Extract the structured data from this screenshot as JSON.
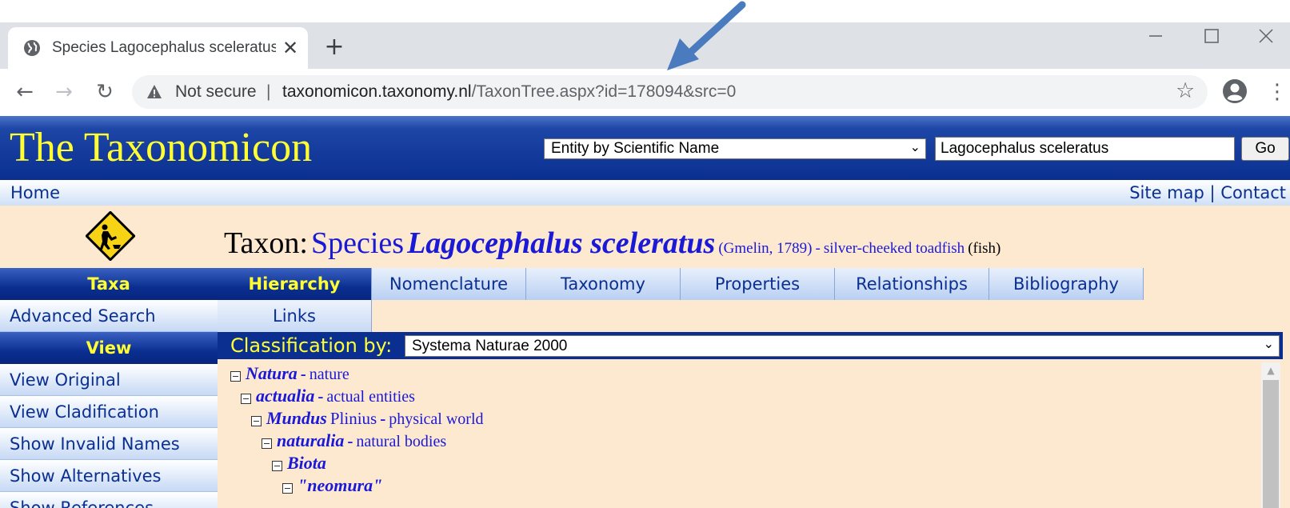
{
  "browser": {
    "tab_title": "Species Lagocephalus sceleratus",
    "tab_close": "✕",
    "new_tab": "+",
    "security_label": "Not secure",
    "omnibox_separator": "|",
    "url_host": "taxonomicon.taxonomy.nl",
    "url_path": "/TaxonTree.aspx?id=178094&src=0",
    "back_icon": "←",
    "forward_icon": "→",
    "reload_icon": "↻",
    "star_icon": "☆",
    "menu_icon": "⋮"
  },
  "header": {
    "site_title": "The Taxonomicon",
    "search_mode": "Entity by Scientific Name",
    "search_value": "Lagocephalus sceleratus",
    "go_label": "Go"
  },
  "navbar": {
    "home": "Home",
    "site_map": "Site map",
    "separator": "|",
    "contact": "Contact"
  },
  "sidebar": [
    {
      "kind": "head",
      "label": "Taxa"
    },
    {
      "kind": "item",
      "label": "Advanced Search"
    },
    {
      "kind": "head",
      "label": "View"
    },
    {
      "kind": "item",
      "label": "View Original"
    },
    {
      "kind": "item",
      "label": "View Cladification"
    },
    {
      "kind": "item",
      "label": "Show Invalid Names"
    },
    {
      "kind": "item",
      "label": "Show Alternatives"
    },
    {
      "kind": "item",
      "label": "Show References"
    }
  ],
  "taxon": {
    "label": "Taxon:",
    "rank": "Species",
    "name": "Lagocephalus sceleratus",
    "author": "(Gmelin, 1789)",
    "common_prefix": "-",
    "common_name": "silver-cheeked toadfish",
    "group": "(fish)"
  },
  "tabs": {
    "row1": [
      "Hierarchy",
      "Nomenclature",
      "Taxonomy",
      "Properties",
      "Relationships",
      "Bibliography"
    ],
    "row2": [
      "Links"
    ],
    "active": "Hierarchy"
  },
  "classification": {
    "label": "Classification by:",
    "selected": "Systema Naturae 2000"
  },
  "tree": [
    {
      "name": "Natura",
      "author": "",
      "dash": "-",
      "common": "nature"
    },
    {
      "name": "actualia",
      "author": "",
      "dash": "-",
      "common": "actual entities"
    },
    {
      "name": "Mundus",
      "author": "Plinius",
      "dash": "-",
      "common": "physical world"
    },
    {
      "name": "naturalia",
      "author": "",
      "dash": "-",
      "common": "natural bodies"
    },
    {
      "name": "Biota",
      "author": "",
      "dash": "",
      "common": ""
    },
    {
      "name": "\"neomura\"",
      "author": "",
      "dash": "",
      "common": ""
    }
  ],
  "colors": {
    "header_blue": "#0a2f90",
    "title_yellow": "#ffff33",
    "content_bg": "#fde8d0",
    "link_blue": "#1a1ad6",
    "annotation_arrow": "#4a7bbf"
  }
}
